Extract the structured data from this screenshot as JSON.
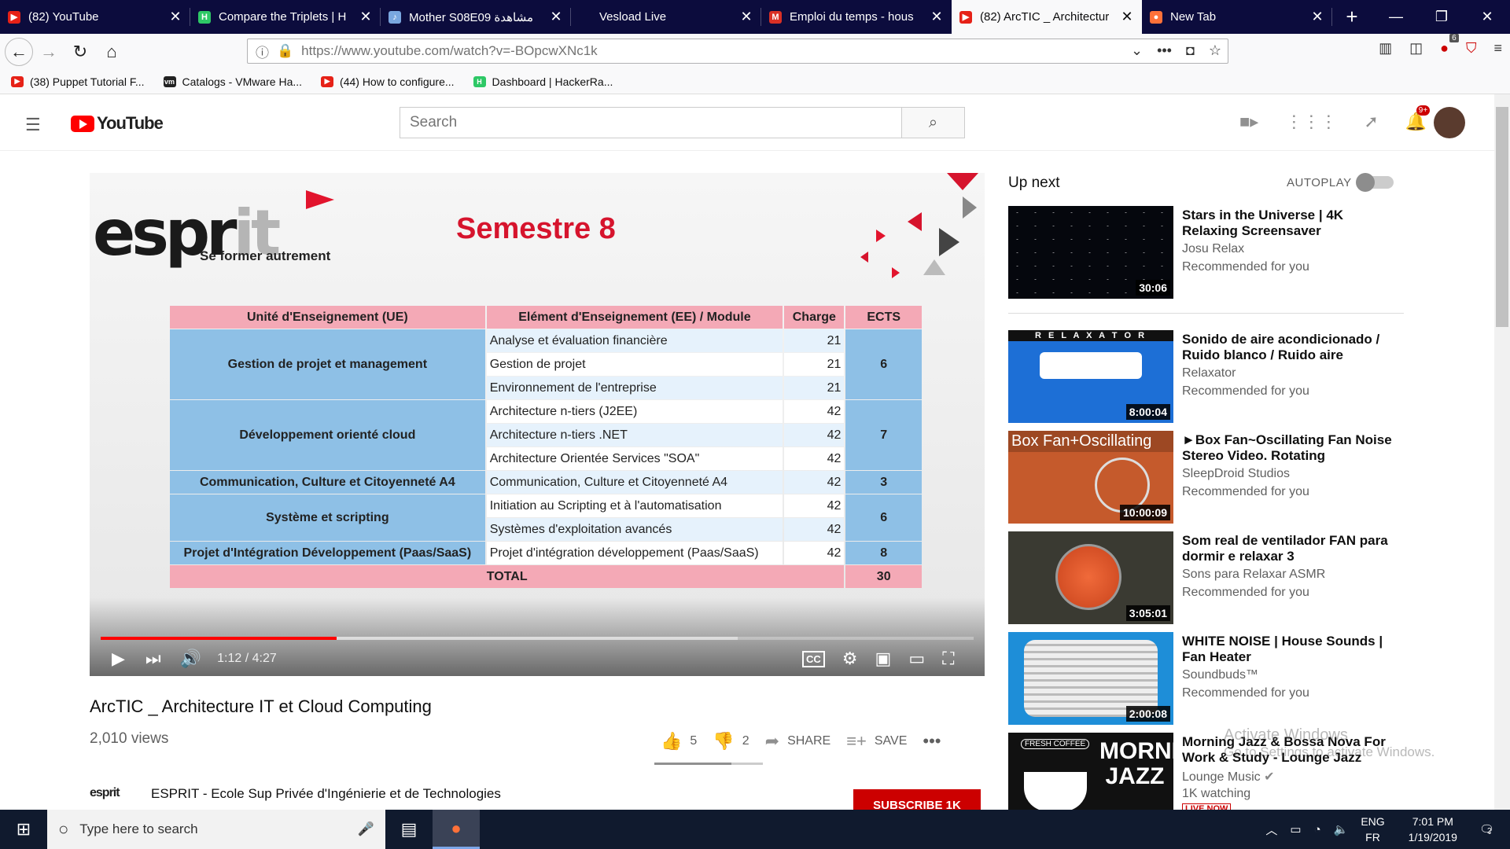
{
  "browser": {
    "tabs": [
      {
        "label": "(82) YouTube",
        "favicon_color": "#e62117",
        "favicon_glyph": "▶"
      },
      {
        "label": "Compare the Triplets | H",
        "favicon_color": "#2ec866",
        "favicon_glyph": "H"
      },
      {
        "label": "Mother S08E09 مشاهدة",
        "favicon_color": "#7aa7e0",
        "favicon_glyph": "♪"
      },
      {
        "label": "Vesload Live",
        "favicon_color": "#0c0c3d",
        "favicon_glyph": ""
      },
      {
        "label": "Emploi du temps - hous",
        "favicon_color": "#d93025",
        "favicon_glyph": "M"
      },
      {
        "label": "(82) ArcTIC _ Architectur",
        "favicon_color": "#e62117",
        "favicon_glyph": "▶"
      },
      {
        "label": "New Tab",
        "favicon_color": "#ff7139",
        "favicon_glyph": "●"
      }
    ],
    "url": "https://www.youtube.com/watch?v=-BOpcwXNc1k",
    "bookmarks": [
      {
        "label": "(38) Puppet Tutorial F...",
        "favicon_color": "#e62117",
        "favicon_glyph": "▶"
      },
      {
        "label": "Catalogs - VMware Ha...",
        "favicon_color": "#222222",
        "favicon_glyph": "vm"
      },
      {
        "label": "(44) How to configure...",
        "favicon_color": "#e62117",
        "favicon_glyph": "▶"
      },
      {
        "label": "Dashboard | HackerRa...",
        "favicon_color": "#2ec866",
        "favicon_glyph": "H"
      }
    ],
    "addon_badge": "6"
  },
  "youtube": {
    "logo": "YouTube",
    "search_placeholder": "Search",
    "notification_badge": "9+"
  },
  "video": {
    "slide": {
      "brand": "espr",
      "brand_it": "it",
      "tagline": "Se former autrement",
      "heading": "Semestre 8",
      "headers": [
        "Unité d'Enseignement (UE)",
        "Elément d'Enseignement (EE) / Module",
        "Charge",
        "ECTS"
      ],
      "groups": [
        {
          "ue": "Gestion de projet et management",
          "ects": "6",
          "rows": [
            [
              "Analyse et évaluation financière",
              "21"
            ],
            [
              "Gestion de projet",
              "21"
            ],
            [
              "Environnement de l'entreprise",
              "21"
            ]
          ]
        },
        {
          "ue": "Développement orienté cloud",
          "ects": "7",
          "rows": [
            [
              "Architecture n-tiers (J2EE)",
              "42"
            ],
            [
              "Architecture n-tiers .NET",
              "42"
            ],
            [
              "Architecture Orientée Services \"SOA\"",
              "42"
            ]
          ]
        },
        {
          "ue": "Communication, Culture et Citoyenneté  A4",
          "ects": "3",
          "rows": [
            [
              "Communication, Culture et Citoyenneté  A4",
              "42"
            ]
          ]
        },
        {
          "ue": "Système et scripting",
          "ects": "6",
          "rows": [
            [
              "Initiation au Scripting et à l'automatisation",
              "42"
            ],
            [
              "Systèmes d'exploitation avancés",
              "42"
            ]
          ]
        },
        {
          "ue": "Projet d'Intégration Développement (Paas/SaaS)",
          "ects": "8",
          "rows": [
            [
              "Projet d'intégration développement (Paas/SaaS)",
              "42"
            ]
          ]
        }
      ],
      "total_label": "TOTAL",
      "total_ects": "30"
    },
    "time": "1:12 / 4:27",
    "progress_fraction": 0.27,
    "buffered_fraction": 0.73,
    "title": "ArcTIC _ Architecture IT et Cloud Computing",
    "views": "2,010 views",
    "likes": "5",
    "dislikes": "2",
    "share_label": "SHARE",
    "save_label": "SAVE",
    "like_fraction": 0.71,
    "channel_logo": "esprit",
    "channel_name": "ESPRIT - Ecole Sup Privée d'Ingénierie et de Technologies",
    "subscribe_label": "SUBSCRIBE  1K"
  },
  "sidebar": {
    "up_next": "Up next",
    "autoplay": "AUTOPLAY",
    "autoplay_on": false,
    "items": [
      {
        "title": "Stars in the Universe | 4K Relaxing Screensaver",
        "channel": "Josu Relax",
        "meta": "Recommended for you",
        "duration": "30:06",
        "thumb_bg": "#05070d"
      },
      {
        "title": "Sonido de aire acondicionado / Ruido blanco / Ruido aire",
        "channel": "Relaxator",
        "meta": "Recommended for you",
        "duration": "8:00:04",
        "thumb_bg": "#1d6fd6",
        "thumb_text": "R E L A X A T O R"
      },
      {
        "title": "►Box Fan~Oscillating Fan Noise Stereo Video. Rotating",
        "channel": "SleepDroid Studios",
        "meta": "Recommended for you",
        "duration": "10:00:09",
        "thumb_bg": "#c55a2c",
        "thumb_text": "Box Fan+Oscillating"
      },
      {
        "title": "Som real de ventilador FAN para dormir e relaxar 3",
        "channel": "Sons para Relaxar ASMR",
        "meta": "Recommended for you",
        "duration": "3:05:01",
        "thumb_bg": "#3a3a32"
      },
      {
        "title": "WHITE NOISE | House Sounds | Fan Heater",
        "channel": "Soundbuds™",
        "meta": "Recommended for you",
        "duration": "2:00:08",
        "thumb_bg": "#1e8ed8"
      },
      {
        "title": "Morning Jazz & Bossa Nova For Work & Study - Lounge Jazz",
        "channel": "Lounge Music",
        "meta": "1K watching",
        "thumb_bg": "#111111",
        "thumb_text": "MORNING JAZZ",
        "thumb_sub": "FRESH COFFEE",
        "live": "LIVE NOW"
      }
    ]
  },
  "watermark": {
    "line1": "Activate Windows",
    "line2": "Go to Settings to activate Windows."
  },
  "taskbar": {
    "search_placeholder": "Type here to search",
    "lang_top": "ENG",
    "lang_bottom": "FR",
    "time": "7:01 PM",
    "date": "1/19/2019",
    "notif_count": "2"
  }
}
